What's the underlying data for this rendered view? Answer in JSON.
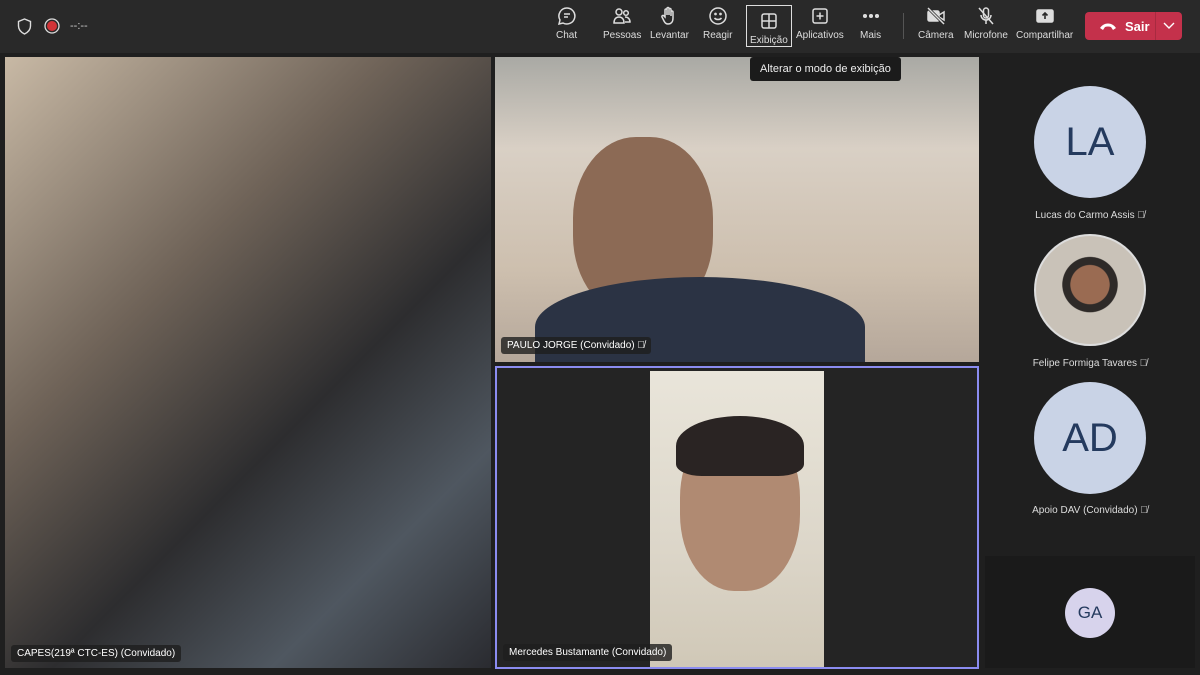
{
  "topbar": {
    "timer": "--:--",
    "buttons": [
      {
        "label": "Chat",
        "icon": "chat-icon"
      },
      {
        "label": "Pessoas",
        "icon": "people-icon"
      },
      {
        "label": "Levantar",
        "icon": "hand-icon"
      },
      {
        "label": "Reagir",
        "icon": "smile-icon"
      },
      {
        "label": "Exibição",
        "icon": "grid-icon"
      },
      {
        "label": "Aplicativos",
        "icon": "plus-icon"
      },
      {
        "label": "Mais",
        "icon": "more-icon"
      },
      {
        "label": "Câmera",
        "icon": "camera-off-icon"
      },
      {
        "label": "Microfone",
        "icon": "mic-off-icon"
      },
      {
        "label": "Compartilhar",
        "icon": "share-icon"
      }
    ],
    "leave": "Sair",
    "tooltip": "Alterar o modo de exibição"
  },
  "tiles": [
    {
      "name": "CAPES(219ª CTC-ES) (Convidado)"
    },
    {
      "name": "PAULO JORGE (Convidado)"
    },
    {
      "name": "Mercedes Bustamante (Convidado)"
    }
  ],
  "roster": [
    {
      "initials": "LA",
      "name": "Lucas do Carmo Assis"
    },
    {
      "initials": "",
      "name": "Felipe Formiga Tavares"
    },
    {
      "initials": "AD",
      "name": "Apoio DAV (Convidado)"
    },
    {
      "initials": "GA",
      "name": ""
    }
  ],
  "colors": {
    "leave": "#c4314b",
    "active_border": "#8b8cf0",
    "record": "#d13438"
  }
}
